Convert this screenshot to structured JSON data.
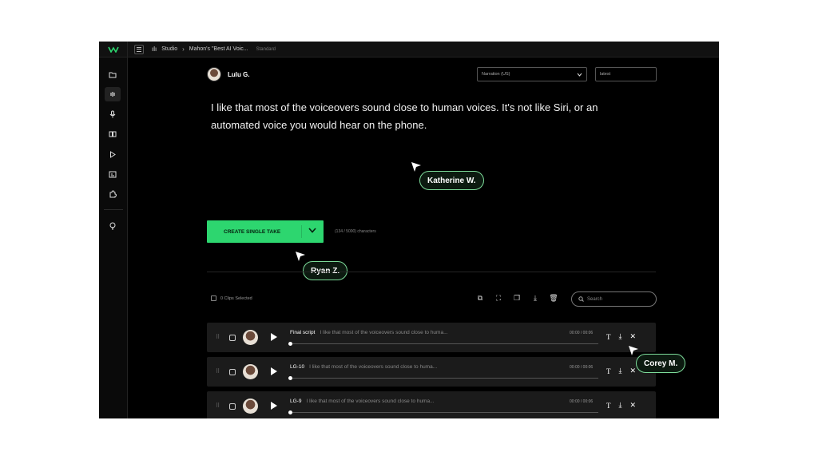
{
  "topbar": {
    "studio_label": "Studio",
    "project_title": "Mahon's \"Best AI Voic...",
    "plan_badge": "Standard"
  },
  "sidebar": {
    "items": [
      {
        "icon": "folder-icon"
      },
      {
        "icon": "waveform-icon",
        "active": true
      },
      {
        "icon": "microphone-icon"
      },
      {
        "icon": "book-icon"
      },
      {
        "icon": "play-icon"
      },
      {
        "icon": "image-icon"
      },
      {
        "icon": "puzzle-icon"
      },
      {
        "icon": "lightbulb-icon"
      }
    ]
  },
  "editor": {
    "speaker_name": "Lulu G.",
    "voice_style": "Narration (US)",
    "version": "latest",
    "text": "I like that most of the voiceovers sound close to human voices. It's not like Siri, or an automated voice you would hear on the phone.",
    "create_button_label": "CREATE SINGLE TAKE",
    "char_count": "(134 / 5000) characters"
  },
  "collaborators": {
    "katherine": "Katherine W.",
    "ryan": "Ryan Z.",
    "corey": "Corey M."
  },
  "clips": {
    "selected_label": "0 Clips Selected",
    "search_placeholder": "Search",
    "items": [
      {
        "title": "Final script",
        "excerpt": "I like that most of the voiceovers sound close to huma...",
        "time": "00:00 / 00:06"
      },
      {
        "title": "LG-10",
        "excerpt": "I like that most of the voiceovers sound close to huma...",
        "time": "00:00 / 00:06"
      },
      {
        "title": "LG-9",
        "excerpt": "I like that most of the voiceovers sound close to huma...",
        "time": "00:00 / 00:06"
      }
    ]
  },
  "colors": {
    "accent": "#2dd66f",
    "background": "#000000",
    "cursor_tag_border": "#7ddc9a"
  }
}
